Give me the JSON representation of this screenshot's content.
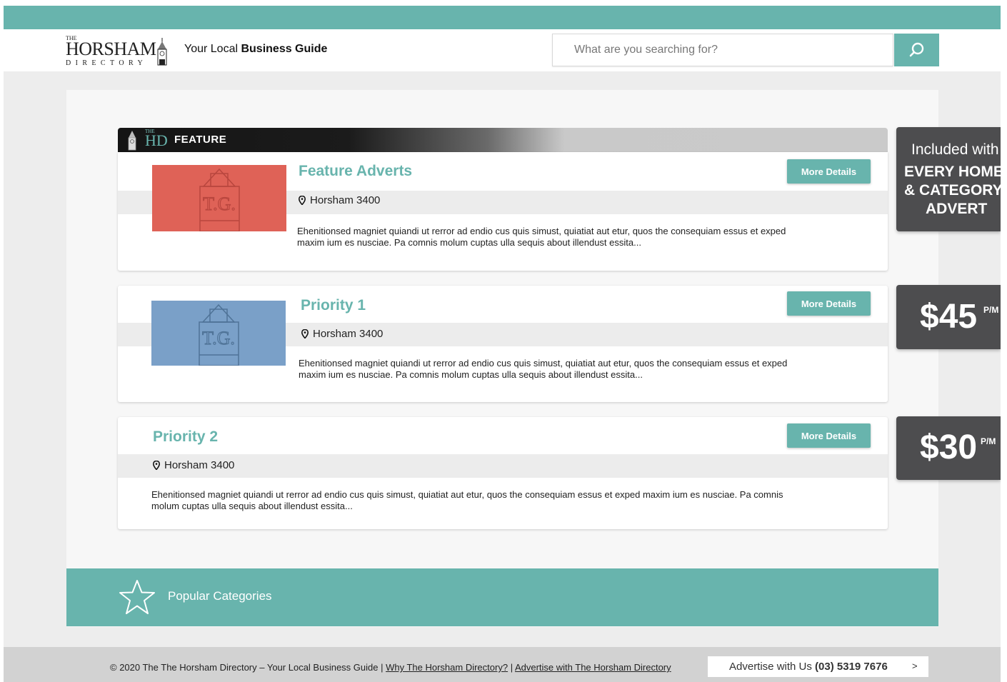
{
  "header": {
    "logo": {
      "the": "THE",
      "name": "HORSHAM",
      "sub": "DIRECTORY"
    },
    "tagline_prefix": "Your Local ",
    "tagline_bold": "Business Guide",
    "search_placeholder": "What are you searching for?"
  },
  "feature_bar": {
    "the": "THE",
    "hd": "HD",
    "label": "FEATURE"
  },
  "listings": [
    {
      "title": "Feature Adverts",
      "location": "Horsham 3400",
      "description_line1": "Ehenitionsed magniet quiandi ut rerror ad endio cus quis simust, quiatiat aut etur, quos the  consequiam essus et exped",
      "description_line2": "maxim ium es nusciae. Pa comnis molum cuptas ulla sequis about illendust essita...",
      "button": "More Details",
      "thumb_color": "#df6257",
      "thumb_label": "T.G."
    },
    {
      "title": "Priority 1",
      "location": "Horsham 3400",
      "description_line1": "Ehenitionsed magniet quiandi ut rerror ad endio cus quis simust, quiatiat aut etur, quos the  consequiam essus et exped",
      "description_line2": "maxim ium es nusciae. Pa comnis molum cuptas ulla sequis about illendust essita...",
      "button": "More Details",
      "thumb_color": "#7aa0c8",
      "thumb_label": "T.G."
    },
    {
      "title": "Priority 2",
      "location": "Horsham 3400",
      "description_line1": "Ehenitionsed magniet quiandi ut rerror ad endio cus quis simust, quiatiat aut etur, quos the  consequiam essus et exped maxim ium es nusciae. Pa comnis",
      "description_line2": "molum cuptas ulla sequis about illendust essita...",
      "button": "More Details"
    }
  ],
  "price_tags": {
    "included": {
      "line1": "Included with",
      "line2": "EVERY HOME",
      "line3": "& CATEGORY",
      "line4": "ADVERT"
    },
    "priority1": {
      "price": "$45",
      "unit": "P/M"
    },
    "priority2": {
      "price": "$30",
      "unit": "P/M"
    }
  },
  "popular": {
    "label": "Popular Categories"
  },
  "footer": {
    "copyright": "© 2020 The The Horsham Directory – Your Local Business Guide",
    "sep": " | ",
    "link1": "Why The Horsham Directory?",
    "link2": "Advertise with The Horsham Directory",
    "advertise_label": "Advertise with Us ",
    "advertise_phone": "(03) 5319 7676",
    "advertise_arrow": ">"
  },
  "colors": {
    "accent": "#68b4ad",
    "dark_tag": "#4d4d4f",
    "red_thumb": "#df6257",
    "blue_thumb": "#7aa0c8"
  }
}
